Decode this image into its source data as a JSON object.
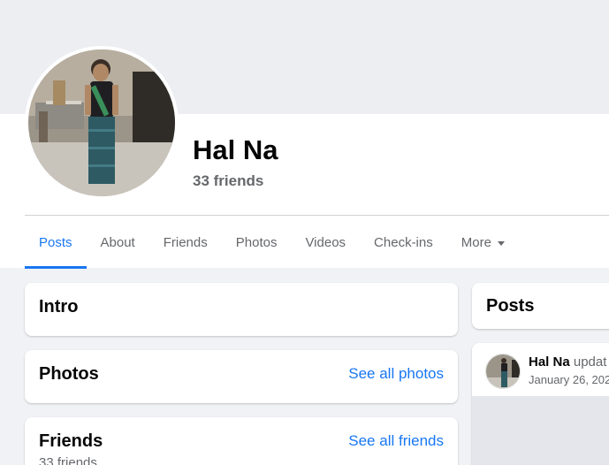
{
  "profile": {
    "name": "Hal Na",
    "friends_count": "33 friends"
  },
  "tabs": [
    {
      "label": "Posts",
      "active": true
    },
    {
      "label": "About"
    },
    {
      "label": "Friends"
    },
    {
      "label": "Photos"
    },
    {
      "label": "Videos"
    },
    {
      "label": "Check-ins"
    },
    {
      "label": "More",
      "icon": "caret-down-icon"
    }
  ],
  "intro": {
    "title": "Intro"
  },
  "photos": {
    "title": "Photos",
    "link": "See all photos"
  },
  "friends": {
    "title": "Friends",
    "link": "See all friends",
    "count": "33 friends"
  },
  "posts": {
    "title": "Posts",
    "first_post": {
      "author": "Hal Na",
      "action": "updat",
      "date": "January 26, 202"
    }
  },
  "colors": {
    "accent": "#1877f2",
    "page_bg": "#f0f2f5",
    "secondary_text": "#65676b"
  }
}
